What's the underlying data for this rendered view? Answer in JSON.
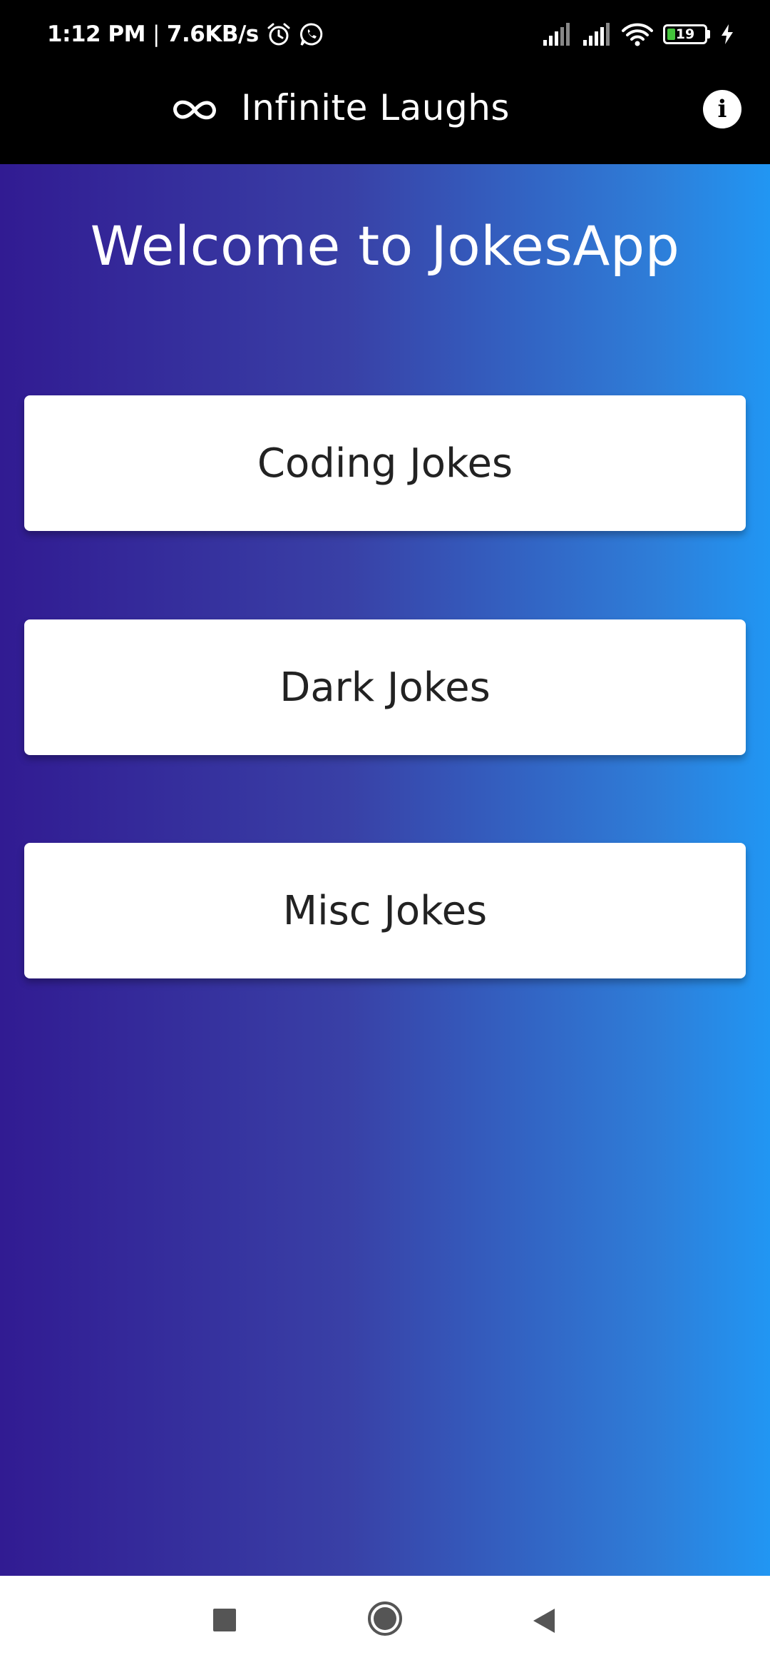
{
  "status_bar": {
    "time": "1:12 PM",
    "separator": "|",
    "net_speed": "7.6KB/s",
    "battery_level": "19",
    "battery_fraction": 0.19,
    "icons": [
      "alarm-icon",
      "whatsapp-icon",
      "signal-icon",
      "signal-icon",
      "wifi-icon",
      "battery-icon",
      "charging-icon"
    ]
  },
  "app_bar": {
    "logo_icon": "infinity-icon",
    "title": "Infinite Laughs",
    "info_icon": "info-icon"
  },
  "main": {
    "welcome": "Welcome to JokesApp",
    "buttons": [
      {
        "label": "Coding Jokes"
      },
      {
        "label": "Dark Jokes"
      },
      {
        "label": "Misc Jokes"
      }
    ]
  },
  "nav_bar": {
    "icons": [
      "recents-icon",
      "home-icon",
      "back-icon"
    ]
  },
  "colors": {
    "gradient_start": "#311b92",
    "gradient_end": "#2196f3",
    "app_bar": "#000000",
    "button_bg": "#ffffff",
    "button_text": "#222222"
  }
}
